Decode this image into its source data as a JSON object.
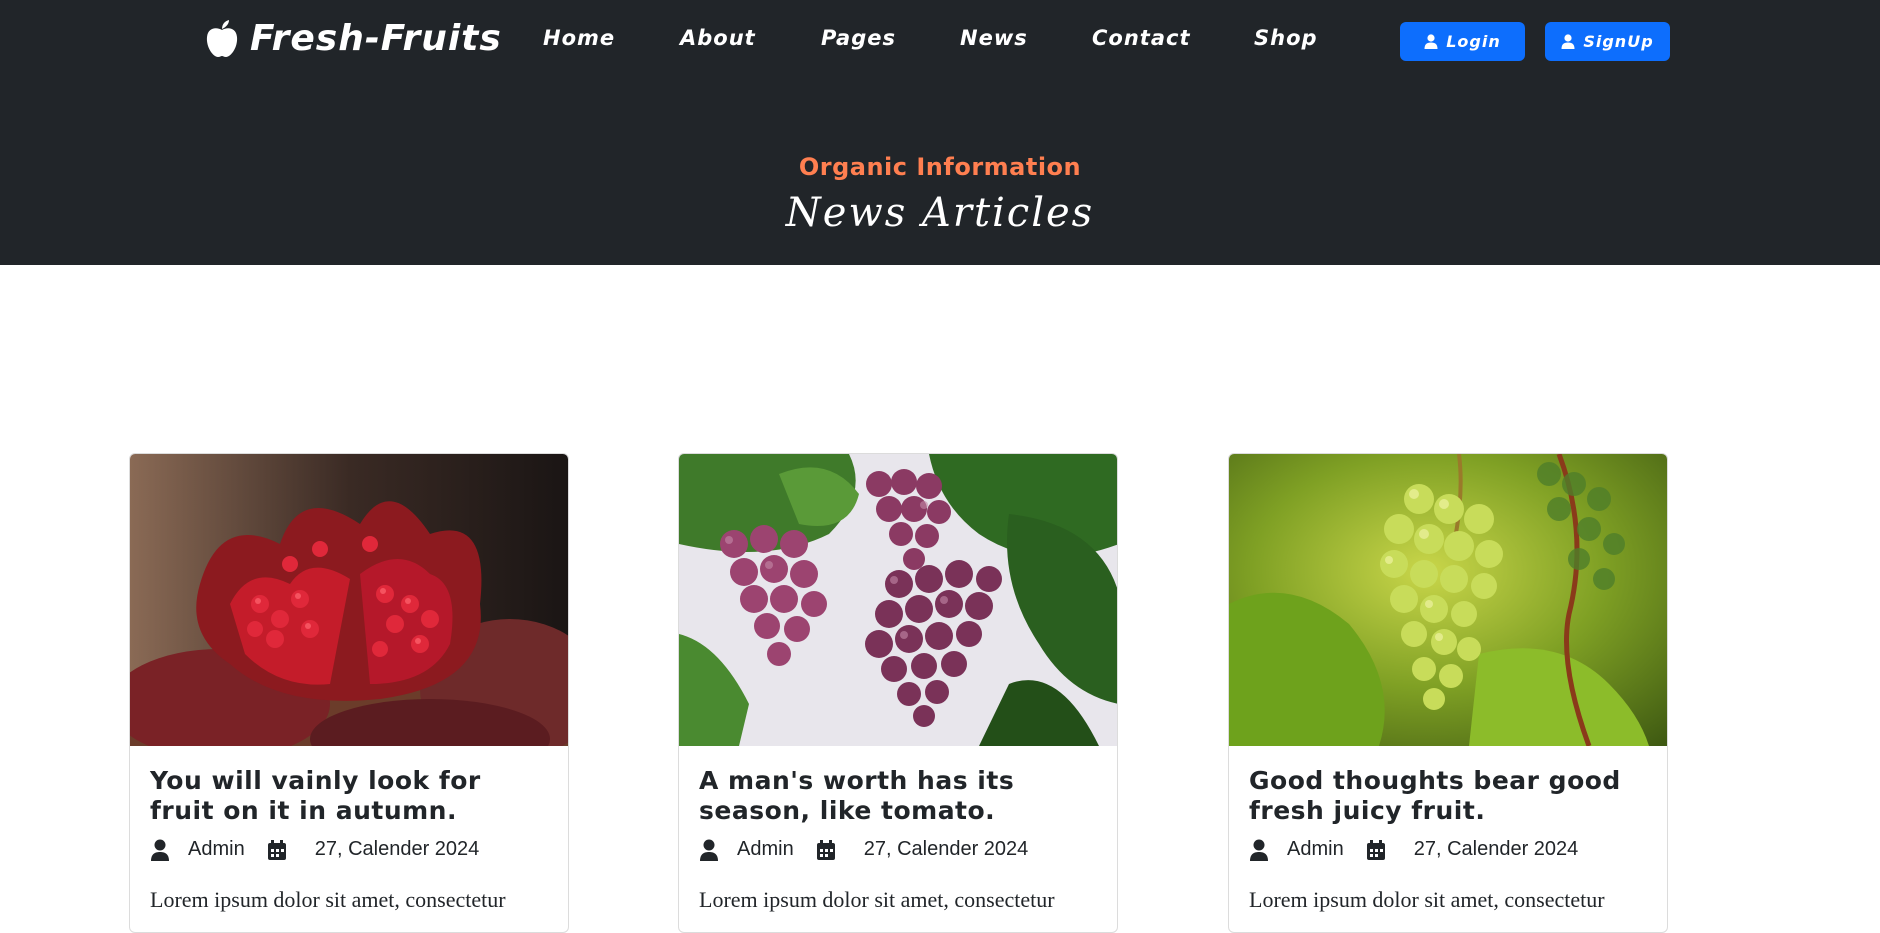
{
  "brand": {
    "name": "Fresh-Fruits",
    "icon": "apple-icon"
  },
  "nav": {
    "items": [
      {
        "label": "Home"
      },
      {
        "label": "About"
      },
      {
        "label": "Pages"
      },
      {
        "label": "News"
      },
      {
        "label": "Contact"
      },
      {
        "label": "Shop"
      }
    ]
  },
  "auth": {
    "login_label": "Login",
    "signup_label": "SignUp",
    "icon": "user-icon",
    "color": "#0d6efd"
  },
  "hero": {
    "subtitle": "Organic Information",
    "title": "News Articles",
    "subtitle_color": "#ff7f50",
    "background": "#212529"
  },
  "articles": [
    {
      "image": "pomegranate-image",
      "title": "You will vainly look for fruit on it in autumn.",
      "author": "Admin",
      "date": "27, Calender 2024",
      "excerpt": "Lorem ipsum dolor sit amet, consectetur"
    },
    {
      "image": "red-grapes-image",
      "title": "A man's worth has its season, like tomato.",
      "author": "Admin",
      "date": "27, Calender 2024",
      "excerpt": "Lorem ipsum dolor sit amet, consectetur"
    },
    {
      "image": "green-grapes-image",
      "title": "Good thoughts bear good fresh juicy fruit.",
      "author": "Admin",
      "date": "27, Calender 2024",
      "excerpt": "Lorem ipsum dolor sit amet, consectetur"
    }
  ]
}
